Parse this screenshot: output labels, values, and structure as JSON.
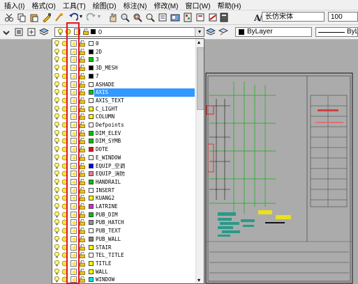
{
  "menu": [
    "插入(I)",
    "格式(O)",
    "工具(T)",
    "绘图(D)",
    "标注(N)",
    "修改(M)",
    "窗口(W)",
    "帮助(H)"
  ],
  "text_style": {
    "font": "长仿宋体",
    "size": "100"
  },
  "layer_combo": {
    "current": "0"
  },
  "properties": {
    "color": "ByLayer",
    "linetype": "ByLayer"
  },
  "layers": [
    {
      "name": "0",
      "color": "#ffffff"
    },
    {
      "name": "2D",
      "color": "#000000"
    },
    {
      "name": "3",
      "color": "#00c000"
    },
    {
      "name": "3D_MESH",
      "color": "#000000"
    },
    {
      "name": "7",
      "color": "#000000"
    },
    {
      "name": "ASHADE",
      "color": "#ffffff"
    },
    {
      "name": "AXIS",
      "color": "#00c000",
      "selected": true
    },
    {
      "name": "AXIS_TEXT",
      "color": "#ffffff"
    },
    {
      "name": "C_LIGHT",
      "color": "#ffff00"
    },
    {
      "name": "COLUMN",
      "color": "#ffff00"
    },
    {
      "name": "Defpoints",
      "color": "#ffffff"
    },
    {
      "name": "DIM_ELEV",
      "color": "#00c000"
    },
    {
      "name": "DIM_SYMB",
      "color": "#00c000"
    },
    {
      "name": "DOTE",
      "color": "#e01010"
    },
    {
      "name": "E_WINDOW",
      "color": "#ffffff"
    },
    {
      "name": "EQUIP_空调",
      "color": "#0000ff"
    },
    {
      "name": "EQUIP_消防",
      "color": "#e080a0"
    },
    {
      "name": "HANDRAIL",
      "color": "#00c000"
    },
    {
      "name": "INSERT",
      "color": "#ffffff"
    },
    {
      "name": "KUANG2",
      "color": "#ffff00"
    },
    {
      "name": "LATRINE",
      "color": "#e020e0"
    },
    {
      "name": "PUB_DIM",
      "color": "#00c000"
    },
    {
      "name": "PUB_HATCH",
      "color": "#909090"
    },
    {
      "name": "PUB_TEXT",
      "color": "#ffffff"
    },
    {
      "name": "PUB_WALL",
      "color": "#808080"
    },
    {
      "name": "STAIR",
      "color": "#ffff00"
    },
    {
      "name": "TEL_TITLE",
      "color": "#ffffff"
    },
    {
      "name": "TITLE",
      "color": "#ffff00"
    },
    {
      "name": "WALL",
      "color": "#ffff00"
    },
    {
      "name": "WINDOW",
      "color": "#00e0e0"
    }
  ],
  "colors": {
    "accent": "#3399ff",
    "highlight": "#e0141e",
    "canvas": "#ababab"
  }
}
